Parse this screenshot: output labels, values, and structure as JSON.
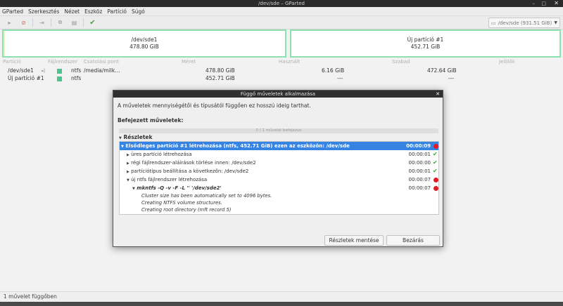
{
  "window": {
    "title": "/dev/sde – GParted"
  },
  "menu": [
    "GParted",
    "Szerkesztés",
    "Nézet",
    "Eszköz",
    "Partíció",
    "Súgó"
  ],
  "toolbar": {
    "device": "/dev/sde (931.51 GiB)"
  },
  "diskmap": [
    {
      "name": "/dev/sde1",
      "size": "478.80 GiB"
    },
    {
      "name": "Új partíció #1",
      "size": "452.71 GiB"
    }
  ],
  "columns": {
    "partition": "Partíció",
    "fs": "Fájlrendszer",
    "mount": "Csatolási pont",
    "size": "Méret",
    "used": "Használt",
    "free": "Szabad",
    "flags": "Jelölők"
  },
  "rows": [
    {
      "partition": "/dev/sde1",
      "fs": "ntfs",
      "mount": "/media/milk…",
      "size": "478.80 GiB",
      "used": "6.16 GiB",
      "free": "472.64 GiB"
    },
    {
      "partition": "Új partíció #1",
      "fs": "ntfs",
      "mount": "",
      "size": "452.71 GiB",
      "used": "---",
      "free": "---"
    }
  ],
  "status": "1 művelet függőben",
  "dialog": {
    "title": "Függő műveletek alkalmazása",
    "message": "A műveletek mennyiségétől és típusától függően ez hosszú ideig tarthat.",
    "completed_label": "Befejezett műveletek:",
    "progress_text": "0 / 1 művelet befejezve",
    "progress": 0,
    "details_label": "Részletek",
    "operations": [
      {
        "text": "Elsődleges partíció #1 létrehozása (ntfs, 452.71 GiB) ezen az eszközön: /dev/sde",
        "time": "00:00:09",
        "status": "error"
      },
      {
        "text": "üres partíció létrehozása",
        "time": "00:00:01",
        "status": "ok"
      },
      {
        "text": "régi fájlrendszer-aláírások törlése innen: /dev/sde2",
        "time": "00:00:00",
        "status": "ok"
      },
      {
        "text": "partíciótípus beállítása a következőn: /dev/sde2",
        "time": "00:00:01",
        "status": "ok"
      },
      {
        "text": "új ntfs fájlrendszer létrehozása",
        "time": "00:00:07",
        "status": "error"
      },
      {
        "text": "mkntfs -Q -v -F -L '' '/dev/sde2'",
        "time": "00:00:07",
        "status": "error"
      }
    ],
    "log": [
      "Cluster size has been automatically set to 4096 bytes.",
      "Creating NTFS volume structures.",
      "Creating root directory (mft record 5)"
    ],
    "save_button": "Részletek mentése",
    "close_button": "Bezárás"
  },
  "colors": {
    "accent": "#3584e4",
    "partition_border": "#8de0b2",
    "ntfs": "#4cc28d",
    "error": "#e01b24",
    "ok": "#3fa53a"
  }
}
